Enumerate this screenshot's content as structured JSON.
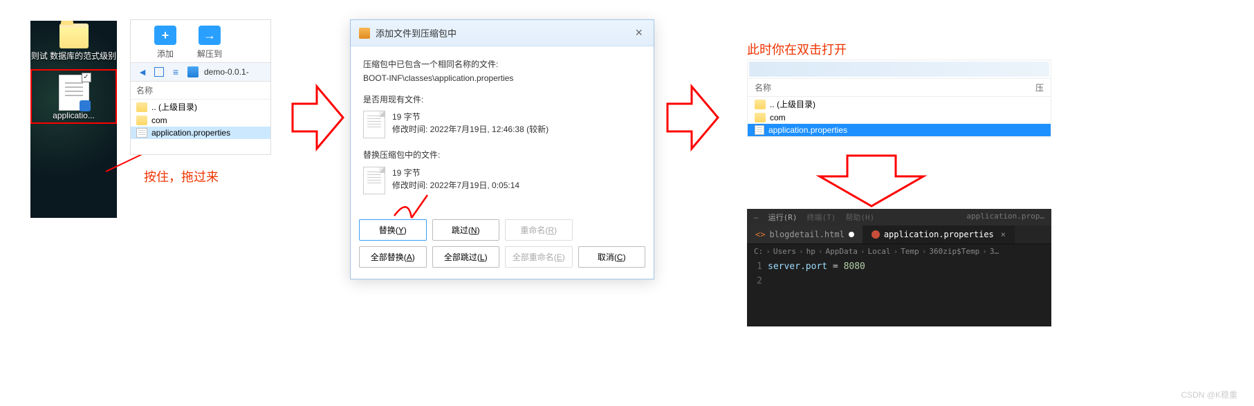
{
  "desktop": {
    "folder_label": "则试 数据库的范式级别",
    "file_label": "applicatio..."
  },
  "annotations": {
    "drag_hint": "按住，拖过来",
    "open_hint": "此时你在双击打开"
  },
  "archive1": {
    "toolbar": {
      "add": "添加",
      "extract": "解压到"
    },
    "nav_path": "demo-0.0.1-",
    "header_name": "名称",
    "rows": {
      "up": ".. (上级目录)",
      "com": "com",
      "app": "application.properties"
    }
  },
  "dialog": {
    "title": "添加文件到压缩包中",
    "line1": "压缩包中已包含一个相同名称的文件:",
    "line2": "BOOT-INF\\classes\\application.properties",
    "q1": "是否用现有文件:",
    "f1_size": "19 字节",
    "f1_mtime": "修改时间: 2022年7月19日, 12:46:38   (较新)",
    "q2": "替换压缩包中的文件:",
    "f2_size": "19 字节",
    "f2_mtime": "修改时间: 2022年7月19日, 0:05:14",
    "btn_replace": "替换",
    "btn_replace_k": "Y",
    "btn_skip": "跳过",
    "btn_skip_k": "N",
    "btn_rename": "重命名",
    "btn_rename_k": "R",
    "btn_replace_all": "全部替换",
    "btn_replace_all_k": "A",
    "btn_skip_all": "全部跳过",
    "btn_skip_all_k": "L",
    "btn_rename_all": "全部重命名",
    "btn_rename_all_k": "E",
    "btn_cancel": "取消",
    "btn_cancel_k": "C"
  },
  "archive2": {
    "header_name": "名称",
    "header_comp": "压",
    "rows": {
      "up": ".. (上级目录)",
      "com": "com",
      "app": "application.properties"
    }
  },
  "vscode": {
    "menu": {
      "run": "运行(R)",
      "term": "终端(T)",
      "help": "帮助(H)"
    },
    "tab1": "blogdetail.html",
    "tab2": "application.properties",
    "crumbs": [
      "C:",
      "Users",
      "hp",
      "AppData",
      "Local",
      "Temp",
      "360zip$Temp",
      "3…"
    ],
    "line1_key": "server.port",
    "line1_eq": " = ",
    "line1_val": "8080",
    "gutter": [
      "1",
      "2"
    ],
    "appfile": "application.prop…"
  },
  "watermark": "CSDN @K稳重"
}
